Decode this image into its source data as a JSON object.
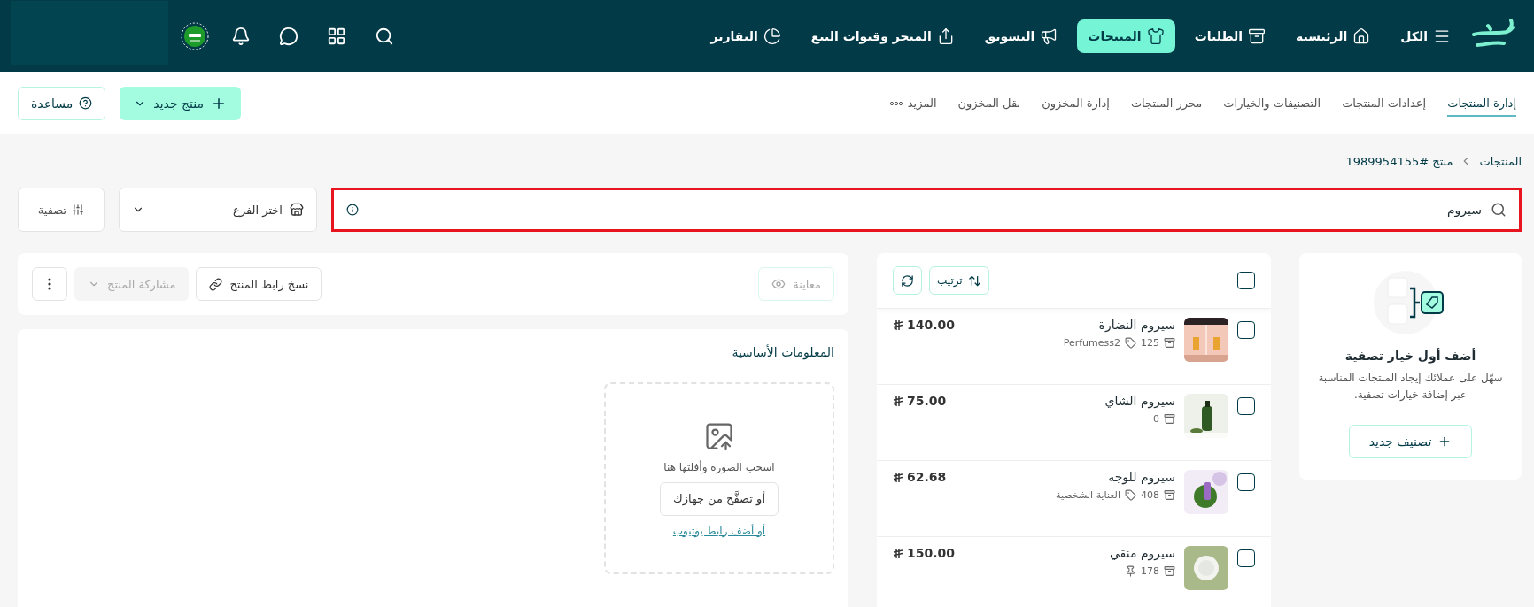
{
  "top_nav": {
    "items": [
      {
        "label": "الكل",
        "selected": false
      },
      {
        "label": "الرئيسية",
        "selected": false
      },
      {
        "label": "الطلبات",
        "selected": false
      },
      {
        "label": "المنتجات",
        "selected": true
      },
      {
        "label": "التسويق",
        "selected": false
      },
      {
        "label": "المتجر وقنوات البيع",
        "selected": false
      },
      {
        "label": "التقارير",
        "selected": false
      }
    ]
  },
  "subnav": {
    "tabs": [
      {
        "label": "إدارة المنتجات",
        "selected": true
      },
      {
        "label": "إعدادات المنتجات",
        "selected": false
      },
      {
        "label": "التصنيفات والخيارات",
        "selected": false
      },
      {
        "label": "محرر المنتجات",
        "selected": false
      },
      {
        "label": "إدارة المخزون",
        "selected": false
      },
      {
        "label": "نقل المخزون",
        "selected": false
      },
      {
        "label": "المزيد",
        "selected": false
      }
    ],
    "new_product": "منتج جديد",
    "help": "مساعدة"
  },
  "breadcrumb": [
    "المنتجات",
    "منتج #1989954155"
  ],
  "search": {
    "value": "سيروم"
  },
  "branch": {
    "placeholder": "اختر الفرع"
  },
  "filter_button": "تصفية",
  "filter_card": {
    "title": "أضف أول خيار تصفية",
    "description": "سهّل على عملائك إيجاد المنتجات المناسبة عبر إضافة خيارات تصفية.",
    "button": "تصنيف جديد"
  },
  "product_list": {
    "select_all_checked": false,
    "sort": "ترتيب",
    "products": [
      {
        "name": "سيروم النضارة",
        "price": "140.00",
        "stock": "125",
        "tag": "Perfumess2",
        "pinned": false,
        "checked": false
      },
      {
        "name": "سيروم الشاي",
        "price": "75.00",
        "stock": "0",
        "pinned": false,
        "checked": false
      },
      {
        "name": "سيروم للوجه",
        "price": "62.68",
        "stock": "408",
        "tag": "العناية الشخصية",
        "pinned": false,
        "checked": false
      },
      {
        "name": "سيروم منقي",
        "price": "150.00",
        "stock": "178",
        "pinned": true,
        "checked": false
      }
    ]
  },
  "toolbar": {
    "preview": {
      "label": "معاينة",
      "disabled": true
    },
    "copy_link": {
      "label": "نسخ رابط المنتج",
      "disabled": false
    },
    "share": {
      "label": "مشاركة المنتج",
      "disabled": true
    }
  },
  "basic_info": {
    "title": "المعلومات الأساسية",
    "drop_text": "اسحب الصورة وأفلتها هنا",
    "browse": "أو تصفَّح من جهازك",
    "youtube": "أو أضف رابط يوتيوب"
  }
}
